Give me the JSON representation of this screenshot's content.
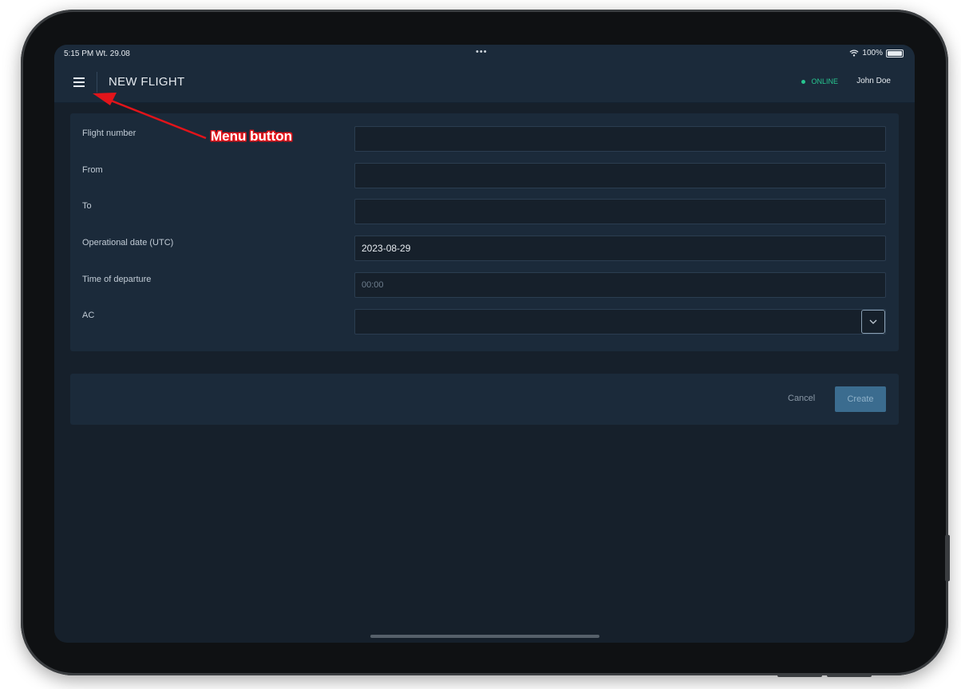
{
  "status_bar": {
    "time_date": "5:15 PM  Wt. 29.08",
    "center_dots": "•••",
    "battery_text": "100%",
    "wifi_icon": "wifi-icon",
    "battery_icon": "battery-icon"
  },
  "navbar": {
    "menu_icon": "hamburger-menu-icon",
    "title": "NEW FLIGHT",
    "status_label": "ONLINE",
    "status_color": "#27c58f",
    "user_name": "John Doe"
  },
  "form": {
    "fields": [
      {
        "label": "Flight number",
        "value": ""
      },
      {
        "label": "From",
        "value": ""
      },
      {
        "label": "To",
        "value": ""
      },
      {
        "label": "Operational date (UTC)",
        "value": "2023-08-29"
      },
      {
        "label": "Time of departure",
        "value": "",
        "placeholder": "00:00"
      },
      {
        "label": "AC",
        "value": "",
        "dropdown_icon": "chevron-down-icon"
      }
    ]
  },
  "actions": {
    "cancel_label": "Cancel",
    "create_label": "Create",
    "create_color": "#3b6c8f"
  },
  "annotation": {
    "text": "Menu button",
    "color": "#e2141a"
  }
}
